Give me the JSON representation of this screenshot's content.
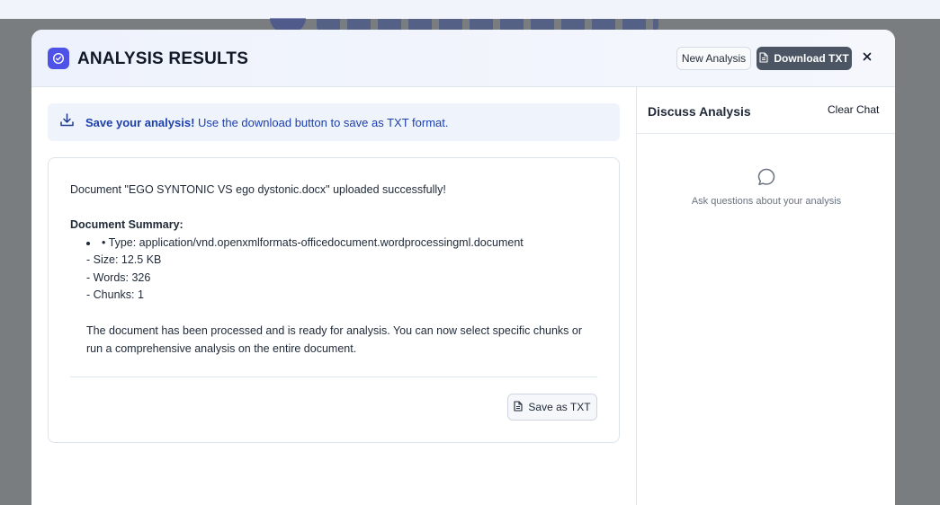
{
  "modal": {
    "title": "ANALYSIS RESULTS",
    "new_analysis_label": "New Analysis",
    "download_label": "Download TXT",
    "close_label": "×"
  },
  "banner": {
    "bold": "Save your analysis!",
    "text": " Use the download button to save as TXT format."
  },
  "result": {
    "upload_message": "Document \"EGO SYNTONIC VS ego dystonic.docx\" uploaded successfully!",
    "summary_heading": "Document Summary:",
    "type_line": "• Type: application/vnd.openxmlformats-officedocument.wordprocessingml.document",
    "size_line": "- Size: 12.5 KB",
    "words_line": "- Words: 326",
    "chunks_line": "- Chunks: 1",
    "closing_paragraph": "The document has been processed and is ready for analysis. You can now select specific chunks or run a comprehensive analysis on the entire document.",
    "save_button_label": "Save as TXT"
  },
  "chat": {
    "title": "Discuss Analysis",
    "clear_label": "Clear Chat",
    "empty_message": "Ask questions about your analysis"
  },
  "colors": {
    "accent": "#4f52e6",
    "download_button": "#4b5563",
    "banner_text": "#1e40af",
    "banner_bg": "#eef3fc"
  },
  "icons": {
    "header": "check-circle-icon",
    "download": "document-icon",
    "banner": "download-icon",
    "save": "document-icon",
    "chat_empty": "chat-bubble-icon"
  }
}
